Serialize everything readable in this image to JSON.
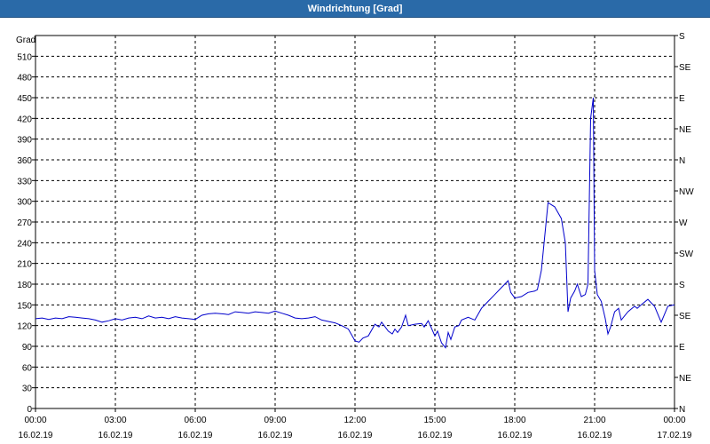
{
  "window": {
    "title": "Windrichtung [Grad]"
  },
  "chart_data": {
    "type": "line",
    "title": "Windrichtung [Grad]",
    "ylabel": "Grad",
    "ylim": [
      0,
      540
    ],
    "y_ticks": [
      0,
      30,
      60,
      90,
      120,
      150,
      180,
      210,
      240,
      270,
      300,
      330,
      360,
      390,
      420,
      450,
      480,
      510
    ],
    "y2_ticks": [
      {
        "value": 0,
        "label": "N"
      },
      {
        "value": 45,
        "label": "NE"
      },
      {
        "value": 90,
        "label": "E"
      },
      {
        "value": 135,
        "label": "SE"
      },
      {
        "value": 180,
        "label": "S"
      },
      {
        "value": 225,
        "label": "SW"
      },
      {
        "value": 270,
        "label": "W"
      },
      {
        "value": 315,
        "label": "NW"
      },
      {
        "value": 360,
        "label": "N"
      },
      {
        "value": 405,
        "label": "NE"
      },
      {
        "value": 450,
        "label": "E"
      },
      {
        "value": 495,
        "label": "SE"
      },
      {
        "value": 540,
        "label": "S"
      }
    ],
    "xlim": [
      "16.02.19 00:00",
      "17.02.19 00:00"
    ],
    "x_ticks": [
      {
        "time": "00:00",
        "date": "16.02.19"
      },
      {
        "time": "03:00",
        "date": "16.02.19"
      },
      {
        "time": "06:00",
        "date": "16.02.19"
      },
      {
        "time": "09:00",
        "date": "16.02.19"
      },
      {
        "time": "12:00",
        "date": "16.02.19"
      },
      {
        "time": "15:00",
        "date": "16.02.19"
      },
      {
        "time": "18:00",
        "date": "16.02.19"
      },
      {
        "time": "21:00",
        "date": "16.02.19"
      },
      {
        "time": "00:00",
        "date": "17.02.19"
      }
    ],
    "grid": true,
    "series": [
      {
        "color": "#0000cc",
        "x_hours": [
          0,
          0.25,
          0.5,
          0.75,
          1,
          1.25,
          1.5,
          1.75,
          2,
          2.25,
          2.5,
          2.75,
          3,
          3.25,
          3.5,
          3.75,
          4,
          4.25,
          4.5,
          4.75,
          5,
          5.25,
          5.5,
          5.75,
          6,
          6.25,
          6.5,
          6.75,
          7,
          7.25,
          7.5,
          7.75,
          8,
          8.25,
          8.5,
          8.75,
          9,
          9.25,
          9.5,
          9.75,
          10,
          10.25,
          10.5,
          10.75,
          11,
          11.25,
          11.5,
          11.75,
          12,
          12.15,
          12.3,
          12.5,
          12.75,
          12.9,
          13,
          13.25,
          13.4,
          13.5,
          13.6,
          13.75,
          13.9,
          14,
          14.25,
          14.5,
          14.6,
          14.75,
          15,
          15.1,
          15.25,
          15.4,
          15.5,
          15.6,
          15.75,
          15.9,
          16,
          16.25,
          16.5,
          16.75,
          17,
          17.25,
          17.5,
          17.75,
          17.85,
          18,
          18.25,
          18.5,
          18.75,
          18.85,
          19,
          19.25,
          19.5,
          19.75,
          19.9,
          20,
          20.1,
          20.25,
          20.35,
          20.5,
          20.65,
          20.75,
          20.85,
          20.95,
          21,
          21.1,
          21.25,
          21.4,
          21.5,
          21.6,
          21.75,
          21.9,
          22,
          22.25,
          22.5,
          22.6,
          22.75,
          23,
          23.25,
          23.5,
          23.75,
          24
        ],
        "y": [
          130,
          131,
          129,
          131,
          130,
          133,
          132,
          131,
          130,
          128,
          125,
          127,
          130,
          128,
          131,
          132,
          130,
          134,
          131,
          132,
          130,
          133,
          131,
          130,
          129,
          135,
          137,
          138,
          137,
          136,
          140,
          139,
          138,
          140,
          139,
          138,
          141,
          138,
          135,
          131,
          130,
          131,
          133,
          128,
          126,
          124,
          120,
          115,
          98,
          96,
          102,
          105,
          122,
          118,
          125,
          112,
          108,
          115,
          110,
          118,
          135,
          120,
          122,
          123,
          118,
          127,
          105,
          112,
          95,
          88,
          110,
          100,
          118,
          120,
          128,
          132,
          128,
          145,
          155,
          165,
          175,
          185,
          168,
          160,
          162,
          168,
          170,
          172,
          200,
          298,
          292,
          275,
          240,
          140,
          160,
          170,
          180,
          162,
          165,
          180,
          420,
          450,
          200,
          165,
          155,
          130,
          108,
          118,
          140,
          145,
          128,
          140,
          148,
          145,
          150,
          158,
          148,
          125,
          148,
          150,
          140,
          142
        ]
      }
    ]
  }
}
